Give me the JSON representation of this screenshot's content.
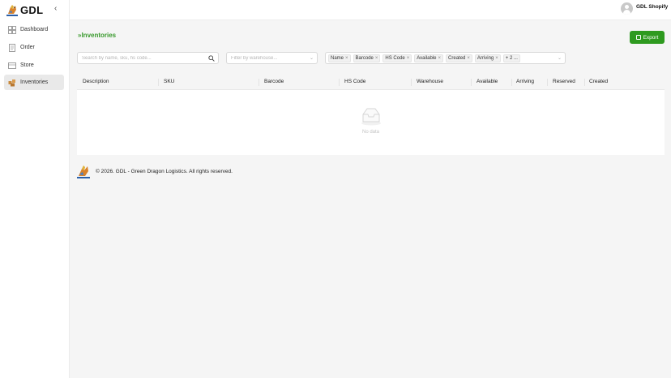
{
  "app": {
    "brand": "GDL",
    "collapse_icon": "chevron-left-icon"
  },
  "sidebar": {
    "items": [
      {
        "label": "Dashboard",
        "icon": "dashboard-icon",
        "active": false
      },
      {
        "label": "Order",
        "icon": "document-icon",
        "active": false
      },
      {
        "label": "Store",
        "icon": "store-icon",
        "active": false
      },
      {
        "label": "Inventories",
        "icon": "boxes-icon",
        "active": true
      }
    ]
  },
  "header": {
    "user_name": "GDL Shopify",
    "avatar_icon": "user-avatar-icon"
  },
  "page": {
    "title": "Inventories",
    "export_label": "Export"
  },
  "filters": {
    "search_placeholder": "Search by name, sku, hs code...",
    "warehouse_placeholder": "Filter by warehouse...",
    "column_tags": [
      "Name",
      "Barcode",
      "HS Code",
      "Available",
      "Created",
      "Arriving"
    ],
    "more_tag": "+ 2 ..."
  },
  "table": {
    "columns": [
      "Description",
      "SKU",
      "Barcode",
      "HS Code",
      "Warehouse",
      "Available",
      "Arriving",
      "Reserved",
      "Created"
    ],
    "rows": [],
    "empty_text": "No data"
  },
  "footer": {
    "text": "© 2026. GDL - Green Dragon Logistics. All rights reserved."
  },
  "colors": {
    "accent": "#3a9a2e",
    "button": "#2e9a1f"
  }
}
